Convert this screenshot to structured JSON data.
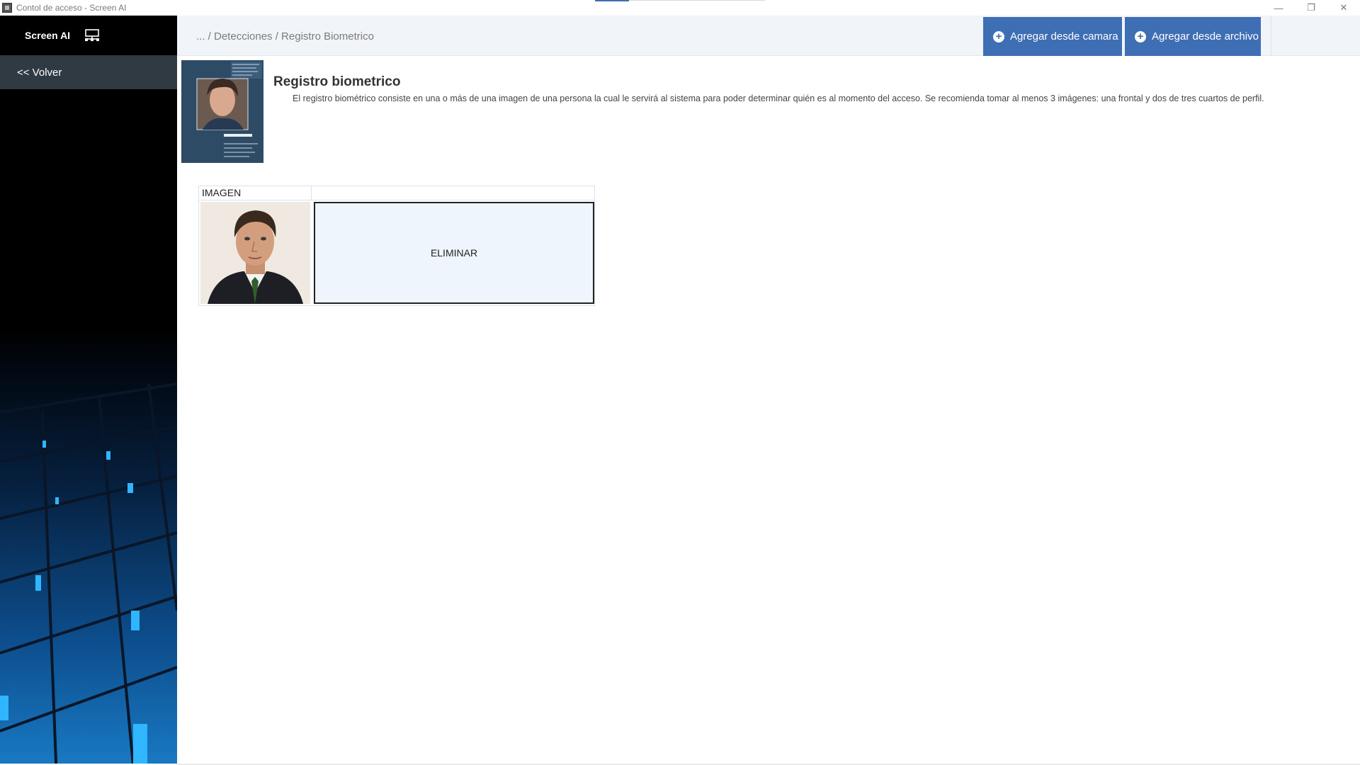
{
  "window": {
    "title": "Contol de acceso - Screen AI",
    "minimize_glyph": "—",
    "restore_glyph": "❐",
    "close_glyph": "✕"
  },
  "sidebar": {
    "brand_name": "Screen AI",
    "brand_icon": "monitor-network-icon",
    "back_label": "<< Volver"
  },
  "header": {
    "breadcrumb": "... / Detecciones / Registro Biometrico",
    "add_camera_label": "Agregar desde camara",
    "add_file_label": "Agregar desde archivo",
    "plus_icon": "plus-circle-icon",
    "accent_color": "#3e6eb4"
  },
  "main": {
    "title": "Registro biometrico",
    "description": "El registro biométrico consiste en una o más de una imagen de una persona la cual le servirá al sistema para poder determinar quién es al momento del acceso. Se recomienda tomar al menos 3 imágenes: una frontal y dos de tres cuartos de perfil.",
    "grid": {
      "columns": [
        "IMAGEN",
        ""
      ],
      "rows": [
        {
          "image_alt": "face-photo",
          "action_label": "ELIMINAR"
        }
      ]
    }
  }
}
